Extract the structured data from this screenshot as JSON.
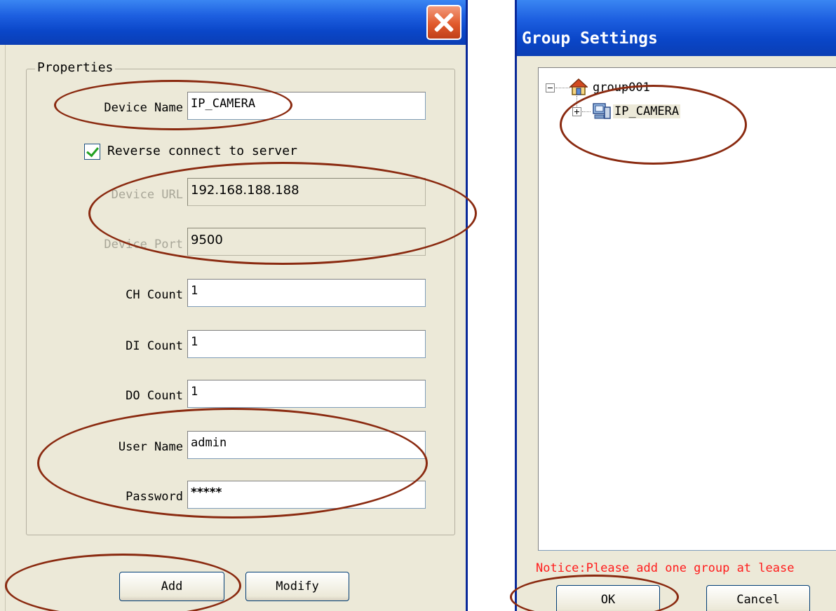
{
  "device_dialog": {
    "groupbox_title": "Properties",
    "fields": {
      "device_name": {
        "label": "Device Name",
        "value": "IP_CAMERA"
      },
      "device_url": {
        "label": "Device URL",
        "value": "192.168.188.188"
      },
      "device_port": {
        "label": "Device Port",
        "value": "9500"
      },
      "ch_count": {
        "label": "CH Count",
        "value": "1"
      },
      "di_count": {
        "label": "DI Count",
        "value": "1"
      },
      "do_count": {
        "label": "DO Count",
        "value": "1"
      },
      "user_name": {
        "label": "User Name",
        "value": "admin"
      },
      "password": {
        "label": "Password",
        "value": "*****"
      }
    },
    "reverse_connect": {
      "label": "Reverse connect to server",
      "checked": true
    },
    "buttons": {
      "add": "Add",
      "modify": "Modify"
    }
  },
  "group_dialog": {
    "title": "Group Settings",
    "tree": {
      "root": {
        "label": "group001",
        "icon": "home-icon",
        "expanded": true
      },
      "child": {
        "label": "IP_CAMERA",
        "icon": "device-icon",
        "expanded": false
      }
    },
    "notice": "Notice:Please add one group at lease",
    "buttons": {
      "ok": "OK",
      "cancel": "Cancel"
    }
  },
  "colors": {
    "titlebar": "#0a46c8",
    "dialog_bg": "#ece9d8",
    "annotation": "#8a2a10",
    "notice": "#ff1c1c"
  }
}
